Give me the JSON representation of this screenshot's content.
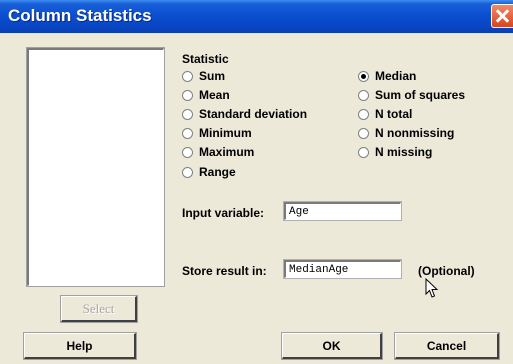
{
  "window": {
    "title": "Column Statistics"
  },
  "statistic": {
    "label": "Statistic",
    "selected": "Median",
    "left_options": [
      "Sum",
      "Mean",
      "Standard deviation",
      "Minimum",
      "Maximum",
      "Range"
    ],
    "right_options": [
      "Median",
      "Sum of squares",
      "N total",
      "N nonmissing",
      "N missing"
    ]
  },
  "input_variable": {
    "label": "Input variable:",
    "value": "Age"
  },
  "store_result": {
    "label": "Store result in:",
    "value": "MedianAge",
    "optional_label": "(Optional)"
  },
  "buttons": {
    "select": "Select",
    "help": "Help",
    "ok": "OK",
    "cancel": "Cancel"
  },
  "colors": {
    "titlebar": "#0a4fd0",
    "dialog_bg": "#ece9d8",
    "close_button": "#d8441c"
  }
}
